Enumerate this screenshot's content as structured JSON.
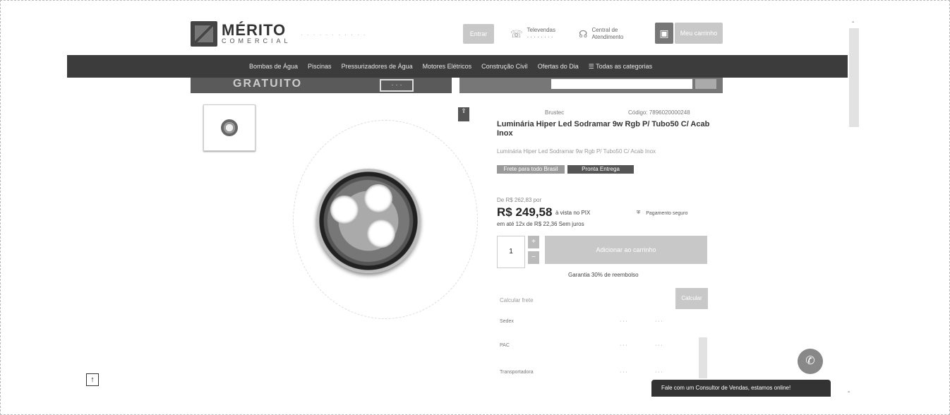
{
  "header": {
    "logo_title": "MÉRITO",
    "logo_sub": "COMERCIAL",
    "tagline": "· · · · · · · · · · ·",
    "login_button": "Entrar",
    "info1_title": "Televendas",
    "info1_sub": "· · · · · · · ·",
    "info2_title": "Central de",
    "info2_sub": "Atendimento",
    "cart_label": "Meu carrinho"
  },
  "nav": {
    "items": [
      "Bombas de Água",
      "Piscinas",
      "Pressurizadores de Água",
      "Motores Elétricos",
      "Construção Civil",
      "Ofertas do Dia",
      "☰ Todas as categorias"
    ]
  },
  "banner": {
    "promo_text": "GRATUITO",
    "promo_box": "· · ·",
    "search_placeholder": ""
  },
  "product": {
    "brand": "Brustec",
    "sku": "Código: 7896020000248",
    "name": "Luminária Hiper Led Sodramar 9w Rgb P/ Tubo50 C/ Acab Inox",
    "description": "Luminária Hiper Led Sodramar 9w Rgb P/ Tubo50 C/ Acab Inox",
    "badge1": "Frete para todo Brasil",
    "badge2": "Pronta Entrega",
    "old_price": "De R$ 262,83 por",
    "price": "R$ 249,58",
    "price_sub": "à vista no PIX",
    "installments": "em até 12x de R$ 22,36 Sem juros",
    "secure_text": "Pagamento seguro",
    "quantity": "1",
    "qty_plus": "+",
    "qty_minus": "−",
    "add_to_cart": "Adicionar ao carrinho",
    "guarantee": "Garantia 30% de reembolso",
    "share_icon": "share-icon"
  },
  "shipping": {
    "label": "Calcular frete",
    "button": "Calcular",
    "rows": [
      {
        "name": "Sedex",
        "days": "· · ·",
        "price": "· · ·"
      },
      {
        "name": "PAC",
        "days": "· · ·",
        "price": "· · ·"
      },
      {
        "name": "Transportadora",
        "days": "· · ·",
        "price": "· · ·"
      }
    ]
  },
  "floating": {
    "chat_text": "Fale com um Consultor de Vendas, estamos online!",
    "whatsapp_icon": "whatsapp-icon",
    "back_to_top": "↑"
  }
}
